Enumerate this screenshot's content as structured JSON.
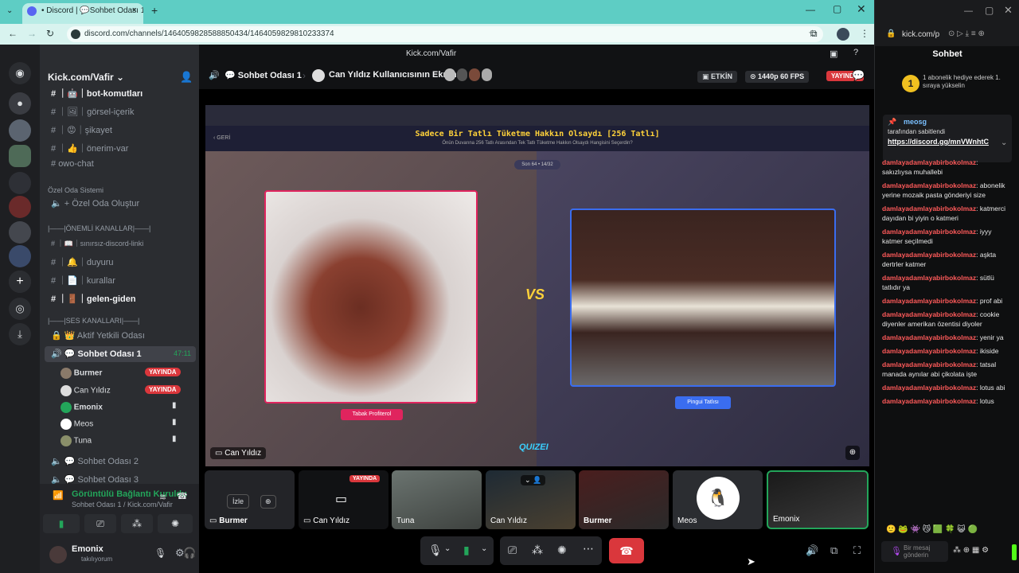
{
  "browser": {
    "tab_title": "• Discord | 💬Sohbet Odası 1",
    "url": "discord.com/channels/1464059828588850434/1464059829810233374",
    "side_url": "kick.com/p"
  },
  "discord": {
    "server_name": "Kick.com/Vafir",
    "channels": [
      {
        "label": "｜🤖｜bot-komutları",
        "bold": true
      },
      {
        "label": "｜🖼｜görsel-içerik",
        "bold": false
      },
      {
        "label": "｜😡｜şikayet",
        "bold": false
      },
      {
        "label": "｜👍｜önerim-var",
        "bold": false
      },
      {
        "label": "owo-chat",
        "bold": false
      }
    ],
    "category_private": "Özel Oda Sistemi",
    "private_create": "Özel Oda Oluştur",
    "category_important": "|——|ÖNEMLİ KANALLAR|——|",
    "important_channels": [
      {
        "label": "｜📖｜sınırsız-discord-linki",
        "bold": false
      },
      {
        "label": "｜🔔｜duyuru",
        "bold": false
      },
      {
        "label": "｜📄｜kurallar",
        "bold": false
      },
      {
        "label": "｜🚪｜gelen-giden",
        "bold": true
      }
    ],
    "category_voice": "|——|SES KANALLARI|——|",
    "voice_channels": {
      "active_mods": "Aktif Yetkili Odası",
      "room1": "Sohbet Odası 1",
      "room1_time": "47:11",
      "room2": "Sohbet Odası 2",
      "room3": "Sohbet Odası 3"
    },
    "voice_users": [
      {
        "name": "Burmer",
        "live": "YAYINDA"
      },
      {
        "name": "Can Yıldız",
        "live": "YAYINDA"
      },
      {
        "name": "Emonix",
        "live": ""
      },
      {
        "name": "Meos",
        "live": ""
      },
      {
        "name": "Tuna",
        "live": ""
      }
    ],
    "connection": {
      "status": "Görüntülü Bağlantı Kuruldu",
      "location": "Sohbet Odası 1 / Kick.com/Vafir"
    },
    "user": {
      "name": "Emonix",
      "status": "takılıyorum"
    }
  },
  "stage": {
    "title_bar": "Kick.com/Vafir",
    "room": "Sohbet Odası 1",
    "screen_title": "Can Yıldız Kullanıcısının Ekranı",
    "activity": "ETKİN",
    "quality": "1440p 60 FPS",
    "live": "YAYINDA",
    "share_label": "Can Yıldız",
    "quiz": {
      "heading": "Sadece Bir Tatlı Tüketme Hakkın Olsaydı [256 Tatlı]",
      "subheading": "Önün Duvarına 256 Tatlı Arasından Tek Tatlı Tüketme Hakkın Olsaydı Hangisini Seçerdin?",
      "round": "Son 64 • 14/32",
      "back": "GERİ",
      "left_label": "Tabak Profiterol",
      "right_label": "Pingui Tatlısı",
      "vs": "VS",
      "logo": "QUIZEI"
    },
    "tiles": [
      {
        "name": "Burmer",
        "action": "İzle"
      },
      {
        "name": "Can Yıldız",
        "live": "YAYINDA"
      },
      {
        "name": "Tuna"
      },
      {
        "name": "Can Yıldız"
      },
      {
        "name": "Burmer"
      },
      {
        "name": "Meos"
      },
      {
        "name": "Emonix"
      }
    ]
  },
  "kick": {
    "panel_title": "Sohbet",
    "gift_text": "1 abonelik hediye ederek 1. sıraya yükselin",
    "pinned_user": "meosg",
    "pinned_note": "tarafından sabitlendi",
    "pinned_link": "https://discord.gg/mnVWnhtC",
    "messages": [
      {
        "user": "damlayadamlayabirbokolmaz",
        "text": "sakızlıysa muhallebi"
      },
      {
        "user": "damlayadamlayabirbokolmaz",
        "text": "abonelik yerine mozaik pasta gönderiyi size"
      },
      {
        "user": "damlayadamlayabirbokolmaz",
        "text": "katmerci dayıdan bi yiyin o katmeri"
      },
      {
        "user": "damlayadamlayabirbokolmaz",
        "text": "iyyy katmer seçilmedi"
      },
      {
        "user": "damlayadamlayabirbokolmaz",
        "text": "aşkta dertrler katmer"
      },
      {
        "user": "damlayadamlayabirbokolmaz",
        "text": "sütlü tatlıdır ya"
      },
      {
        "user": "damlayadamlayabirbokolmaz",
        "text": "prof abi"
      },
      {
        "user": "damlayadamlayabirbokolmaz",
        "text": "cookie diyenler amerikan özentisi diyoler"
      },
      {
        "user": "damlayadamlayabirbokolmaz",
        "text": "yenir ya"
      },
      {
        "user": "damlayadamlayabirbokolmaz",
        "text": "ikiside"
      },
      {
        "user": "damlayadamlayabirbokolmaz",
        "text": "tatsal manada aynılar abi çikolata işte"
      },
      {
        "user": "damlayadamlayabirbokolmaz",
        "text": "lotus abi"
      },
      {
        "user": "damlayadamlayabirbokolmaz",
        "text": "lotus"
      }
    ],
    "input_placeholder": "Bir mesaj gönderin"
  },
  "colors": {
    "accent": "#5865f2",
    "live": "#da373c",
    "kick_green": "#53fc18",
    "chat_user": "#ff5a5a"
  }
}
